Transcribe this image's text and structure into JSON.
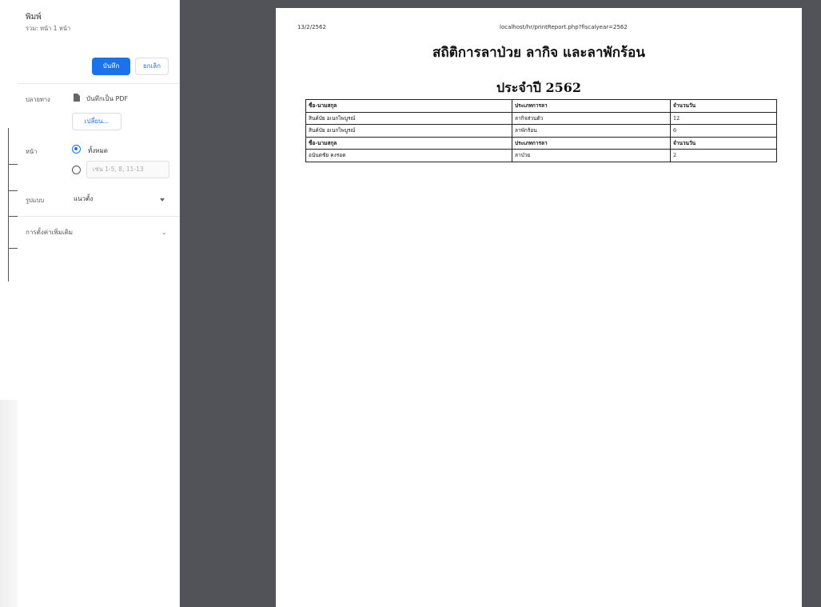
{
  "print_dialog": {
    "title": "พิมพ์",
    "sheet_count": "รวม: หน้า 1 หน้า",
    "save_label": "บันทึก",
    "cancel_label": "ยกเลิก",
    "destination_label": "ปลายทาง",
    "destination_value": "บันทึกเป็น PDF",
    "change_label": "เปลี่ยน...",
    "pages_label": "หน้า",
    "pages_all_label": "ทั้งหมด",
    "pages_custom_placeholder": "เช่น 1-5, 8, 11-13",
    "layout_label": "รูปแบบ",
    "layout_value": "แนวตั้ง",
    "more_settings_label": "การตั้งค่าเพิ่มเติม",
    "accent_color": "#1a73e8"
  },
  "preview": {
    "header_date": "13/2/2562",
    "header_url": "localhost/hr/printReport.php?fiscalyear=2562",
    "title": "สถิติการลาป่วย ลากิจ และลาพักร้อน",
    "subtitle": "ประจำปี 2562",
    "table": {
      "rows": [
        {
          "name": "ชื่อ-นามสกุล",
          "type": "ประเภทการลา",
          "days": "จำนวนวัน",
          "header": true
        },
        {
          "name": "สินค์บัย อเนกไพบูรณ์",
          "type": "ลากิจส่วนตัว",
          "days": "12",
          "header": false
        },
        {
          "name": "สินค์บัย อเนกไพบูรณ์",
          "type": "ลาพักร้อน",
          "days": "6",
          "header": false
        },
        {
          "name": "ชื่อ-นามสกุล",
          "type": "ประเภทการลา",
          "days": "จำนวนวัน",
          "header": true
        },
        {
          "name": "อนันตชัย คงรอด",
          "type": "ลาป่วย",
          "days": "2",
          "header": false
        }
      ]
    }
  }
}
